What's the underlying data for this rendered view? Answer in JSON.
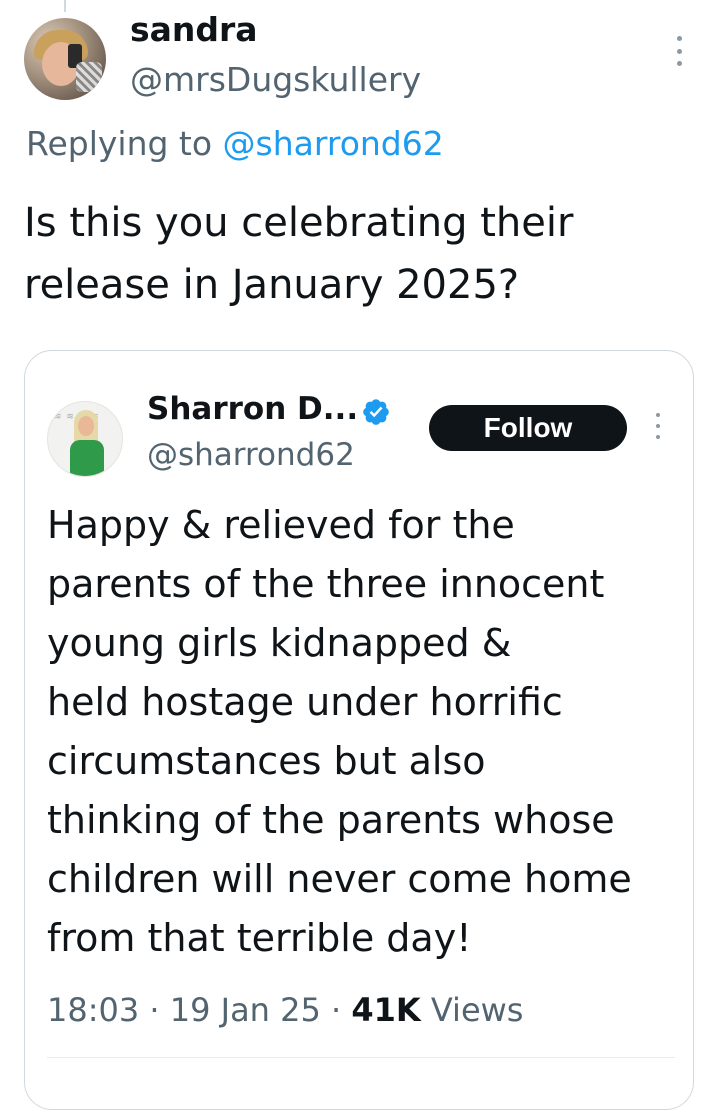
{
  "reply": {
    "author_name": "sandra",
    "author_handle": "@mrsDugskullery",
    "replying_prefix": "Replying to ",
    "replying_to": "@sharrond62",
    "text": "Is this you celebrating their release in January 2025?"
  },
  "quoted": {
    "author_name": "Sharron D...",
    "author_handle": "@sharrond62",
    "verified": true,
    "follow_label": "Follow",
    "text_lines": [
      "Happy & relieved for the",
      "parents of the three innocent",
      "young girls kidnapped &",
      "held hostage under horrific",
      "circumstances but also",
      "thinking of the parents whose",
      "children will never come home",
      "from that terrible day!"
    ],
    "time": "18:03",
    "date": "19 Jan 25",
    "views_count": "41K",
    "views_label": "Views"
  },
  "icons": {
    "more": "more-vertical-icon",
    "verified": "verified-badge-icon"
  },
  "colors": {
    "link": "#1d9bf0",
    "secondary_text": "#536471",
    "primary_text": "#0f1419",
    "border": "#cfd9de",
    "verified": "#1d9bf0"
  }
}
